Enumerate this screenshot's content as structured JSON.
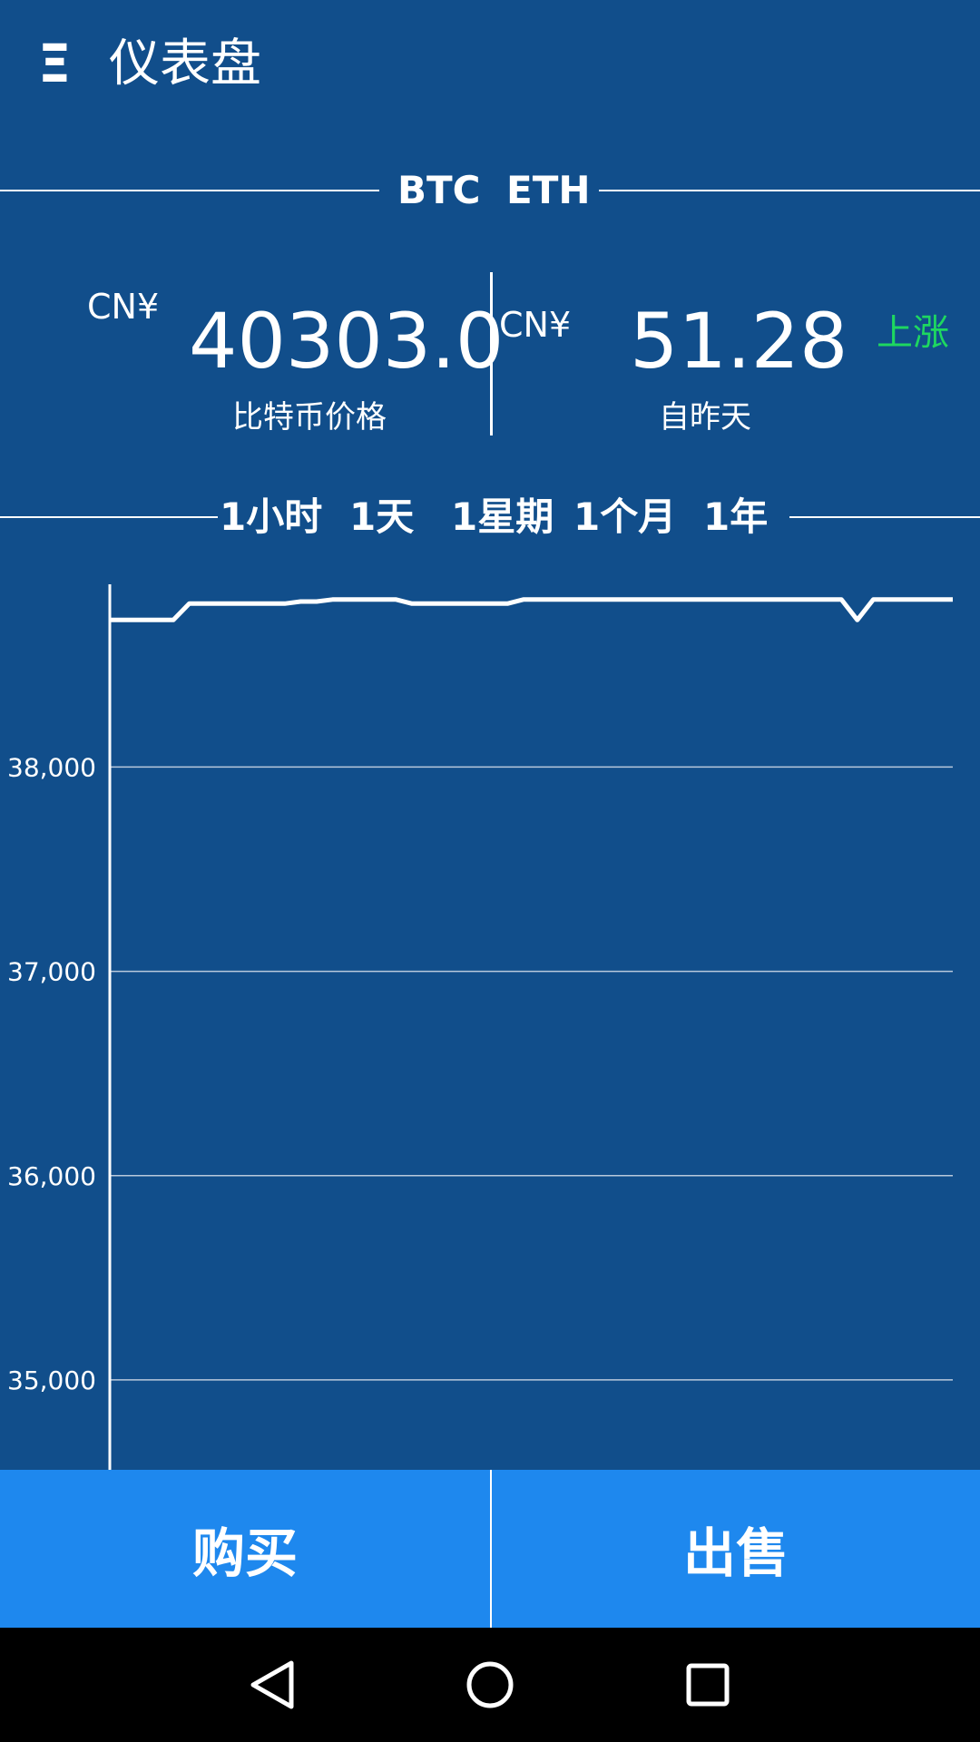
{
  "appbar": {
    "title": "仪表盘",
    "menu_icon": "Ξ"
  },
  "coins": {
    "btc": "BTC",
    "eth": "ETH"
  },
  "price": {
    "currency_left": "CN¥",
    "value": "40303.0",
    "label": "比特币价格",
    "currency_right": "CN¥",
    "change": "51.28",
    "change_label": "自昨天",
    "trend": "上涨",
    "trend_color": "#1ed760"
  },
  "ranges": [
    "1小时",
    "1天",
    "1星期",
    "1个月",
    "1年"
  ],
  "chart_data": {
    "type": "line",
    "y_ticks": [
      "38,000",
      "37,000",
      "36,000",
      "35,000"
    ],
    "ylim": [
      34560,
      38890
    ],
    "grid": true,
    "series": [
      {
        "values": [
          38720,
          38720,
          38720,
          38720,
          38720,
          38800,
          38800,
          38800,
          38800,
          38800,
          38800,
          38800,
          38810,
          38810,
          38820,
          38820,
          38820,
          38820,
          38820,
          38800,
          38800,
          38800,
          38800,
          38800,
          38800,
          38800,
          38820,
          38820,
          38820,
          38820,
          38820,
          38820,
          38820,
          38820,
          38820,
          38820,
          38820,
          38820,
          38820,
          38820,
          38820,
          38820,
          38820,
          38820,
          38820,
          38820,
          38820,
          38720,
          38820,
          38820,
          38820,
          38820,
          38820,
          38820
        ]
      }
    ]
  },
  "actions": {
    "buy": "购买",
    "sell": "出售"
  },
  "nav": {
    "back": "back-icon",
    "home": "home-icon",
    "recents": "recents-icon"
  }
}
